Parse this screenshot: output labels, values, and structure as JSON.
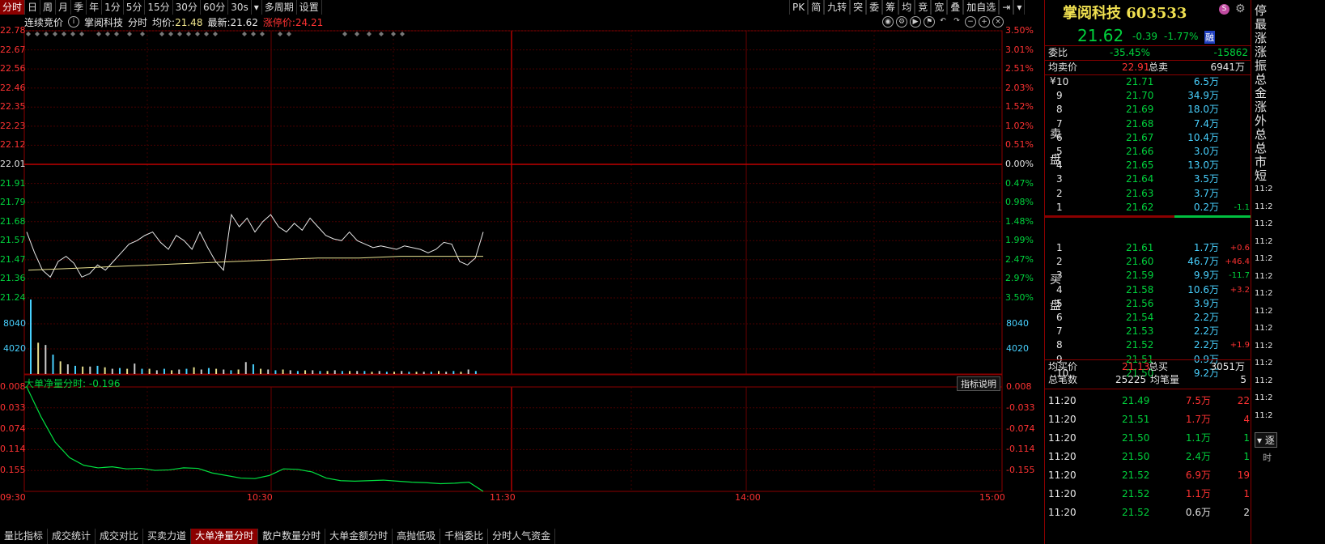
{
  "toolbar": {
    "items": [
      "分时",
      "日",
      "周",
      "月",
      "季",
      "年",
      "1分",
      "5分",
      "15分",
      "30分",
      "60分",
      "30s",
      "▾",
      "多周期",
      "设置"
    ],
    "right_items": [
      "PK",
      "简",
      "九转",
      "突",
      "委",
      "筹",
      "均",
      "竞",
      "宽",
      "叠",
      "加自选",
      "⇥",
      "▾"
    ]
  },
  "info": {
    "auction": "连续竞价",
    "name": "掌阅科技",
    "mode": "分时",
    "avg_label": "均价:",
    "avg_value": "21.48",
    "last_label": "最新:",
    "last_value": "21.62",
    "limit_label": "涨停价:",
    "limit_value": "24.21"
  },
  "price_axis": {
    "left": [
      "22.78",
      "22.67",
      "22.56",
      "22.46",
      "22.35",
      "22.23",
      "22.12",
      "22.01",
      "21.91",
      "21.79",
      "21.68",
      "21.57",
      "21.47",
      "21.36",
      "21.24"
    ],
    "right": [
      "3.50%",
      "3.01%",
      "2.51%",
      "2.03%",
      "1.52%",
      "1.02%",
      "0.51%",
      "0.00%",
      "0.47%",
      "0.98%",
      "1.48%",
      "1.99%",
      "2.47%",
      "2.97%",
      "3.50%"
    ]
  },
  "volume_axis": {
    "left": [
      "8040",
      "4020"
    ],
    "right": [
      "8040",
      "4020"
    ]
  },
  "indicator": {
    "label": "大单净量分时: -0.196",
    "explain": "指标说明",
    "left": [
      "0.008",
      "0.033",
      "0.074",
      "0.114",
      "0.155"
    ],
    "right": [
      "0.008",
      "-0.033",
      "-0.074",
      "-0.114",
      "-0.155"
    ]
  },
  "time_axis": [
    "09:30",
    "10:30",
    "11:30",
    "14:00",
    "15:00"
  ],
  "bottom_tabs": [
    "量比指标",
    "成交统计",
    "成交对比",
    "买卖力道",
    "大单净量分时",
    "散户数量分时",
    "大单金额分时",
    "高抛低吸",
    "千档委比",
    "分时人气资金"
  ],
  "stock": {
    "title": "掌阅科技 603533",
    "price": "21.62",
    "change": "-0.39",
    "pct": "-1.77%",
    "tag": "融",
    "webi_label": "委比",
    "webi_value": "-35.45%",
    "webi_diff": "-15862",
    "avg_sell_label": "均卖价",
    "avg_sell_value": "22.91",
    "total_sell_label": "总卖",
    "total_sell_value": "6941万",
    "avg_buy_label": "均买价",
    "avg_buy_value": "21.13",
    "total_buy_label": "总买",
    "total_buy_value": "3051万",
    "trades_label": "总笔数",
    "trades_value": "25225",
    "avg_vol_label": "均笔量",
    "avg_vol_value": "5",
    "sell_label": "卖盘",
    "buy_label": "买盘",
    "yen": "¥"
  },
  "sell_book": [
    {
      "level": "10",
      "price": "21.71",
      "vol": "6.5万",
      "chg": ""
    },
    {
      "level": "9",
      "price": "21.70",
      "vol": "34.9万",
      "chg": ""
    },
    {
      "level": "8",
      "price": "21.69",
      "vol": "18.0万",
      "chg": ""
    },
    {
      "level": "7",
      "price": "21.68",
      "vol": "7.4万",
      "chg": ""
    },
    {
      "level": "6",
      "price": "21.67",
      "vol": "10.4万",
      "chg": ""
    },
    {
      "level": "5",
      "price": "21.66",
      "vol": "3.0万",
      "chg": ""
    },
    {
      "level": "4",
      "price": "21.65",
      "vol": "13.0万",
      "chg": ""
    },
    {
      "level": "3",
      "price": "21.64",
      "vol": "3.5万",
      "chg": ""
    },
    {
      "level": "2",
      "price": "21.63",
      "vol": "3.7万",
      "chg": ""
    },
    {
      "level": "1",
      "price": "21.62",
      "vol": "0.2万",
      "chg": "-1.1"
    }
  ],
  "buy_book": [
    {
      "level": "1",
      "price": "21.61",
      "vol": "1.7万",
      "chg": "+0.6"
    },
    {
      "level": "2",
      "price": "21.60",
      "vol": "46.7万",
      "chg": "+46.4"
    },
    {
      "level": "3",
      "price": "21.59",
      "vol": "9.9万",
      "chg": "-11.7"
    },
    {
      "level": "4",
      "price": "21.58",
      "vol": "10.6万",
      "chg": "+3.2"
    },
    {
      "level": "5",
      "price": "21.56",
      "vol": "3.9万",
      "chg": ""
    },
    {
      "level": "6",
      "price": "21.54",
      "vol": "2.2万",
      "chg": ""
    },
    {
      "level": "7",
      "price": "21.53",
      "vol": "2.2万",
      "chg": ""
    },
    {
      "level": "8",
      "price": "21.52",
      "vol": "2.2万",
      "chg": "+1.9"
    },
    {
      "level": "9",
      "price": "21.51",
      "vol": "0.9万",
      "chg": ""
    },
    {
      "level": "10",
      "price": "21.50",
      "vol": "9.2万",
      "chg": ""
    }
  ],
  "ticks": [
    {
      "time": "11:20",
      "price": "21.49",
      "vol": "7.5万",
      "n": "22",
      "color": "red"
    },
    {
      "time": "11:20",
      "price": "21.51",
      "vol": "1.7万",
      "n": "4",
      "color": "red"
    },
    {
      "time": "11:20",
      "price": "21.50",
      "vol": "1.1万",
      "n": "1",
      "color": "green"
    },
    {
      "time": "11:20",
      "price": "21.50",
      "vol": "2.4万",
      "n": "1",
      "color": "green"
    },
    {
      "time": "11:20",
      "price": "21.52",
      "vol": "6.9万",
      "n": "19",
      "color": "red"
    },
    {
      "time": "11:20",
      "price": "21.52",
      "vol": "1.1万",
      "n": "1",
      "color": "red"
    },
    {
      "time": "11:20",
      "price": "21.52",
      "vol": "0.6万",
      "n": "2",
      "color": "white"
    }
  ],
  "far_right": {
    "labels": [
      "停",
      "最",
      "涨",
      "涨",
      "振",
      "总",
      "金",
      "涨",
      "外",
      "总",
      "总",
      "市",
      "短"
    ],
    "times": [
      "11:2",
      "11:2",
      "11:2",
      "11:2",
      "11:2",
      "11:2",
      "11:2",
      "11:2",
      "11:2",
      "11:2",
      "11:2",
      "11:2",
      "11:2",
      "11:2"
    ],
    "bottom_btn": "▾ 逐",
    "bottom_label": "时"
  },
  "chart_data": {
    "type": "line",
    "title": "掌阅科技 分时",
    "x_range": [
      "09:30",
      "15:00"
    ],
    "ylim": [
      21.24,
      22.78
    ],
    "prev_close": 22.01,
    "series": [
      {
        "name": "price",
        "values": [
          21.62,
          21.5,
          21.4,
          21.36,
          21.45,
          21.48,
          21.44,
          21.36,
          21.38,
          21.43,
          21.4,
          21.45,
          21.5,
          21.55,
          21.57,
          21.6,
          21.62,
          21.56,
          21.52,
          21.6,
          21.57,
          21.52,
          21.62,
          21.53,
          21.45,
          21.4,
          21.72,
          21.65,
          21.7,
          21.62,
          21.68,
          21.72,
          21.65,
          21.62,
          21.67,
          21.63,
          21.7,
          21.65,
          21.6,
          21.58,
          21.57,
          21.62,
          21.57,
          21.55,
          21.53,
          21.54,
          21.53,
          21.52,
          21.54,
          21.53,
          21.52,
          21.5,
          21.52,
          21.56,
          21.55,
          21.45,
          21.43,
          21.47,
          21.62
        ]
      },
      {
        "name": "avg",
        "values": [
          21.4,
          21.41,
          21.42,
          21.43,
          21.44,
          21.45,
          21.46,
          21.47,
          21.47,
          21.48,
          21.48,
          21.48
        ]
      }
    ],
    "volume": [
      10000,
      4200,
      3900,
      2600,
      1700,
      1300,
      1100,
      1000,
      1000,
      1100,
      900,
      700,
      800,
      700,
      1400,
      700,
      700,
      500,
      700,
      500,
      600,
      700,
      900,
      600,
      800,
      700,
      600,
      500,
      600,
      1600,
      1300,
      700,
      600,
      500,
      600,
      500,
      400,
      500,
      500,
      400,
      400,
      500,
      400,
      400,
      400,
      400,
      300,
      400,
      300,
      300,
      400,
      300,
      300,
      300,
      300,
      400,
      300,
      400,
      300,
      600,
      400
    ],
    "indicator": {
      "name": "大单净量分时",
      "current": -0.196,
      "ylim": [
        -0.196,
        0.008
      ]
    }
  }
}
